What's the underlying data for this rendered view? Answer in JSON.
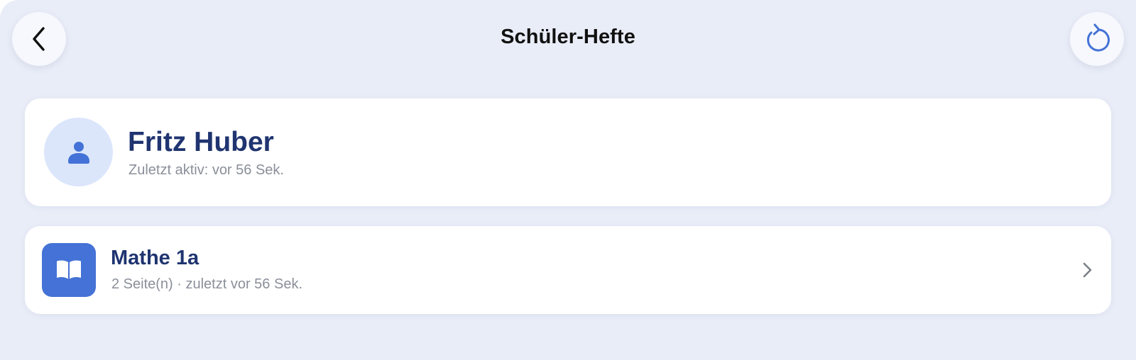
{
  "header": {
    "title": "Schüler-Hefte",
    "back_icon": "chevron-left-icon",
    "refresh_icon": "refresh-icon"
  },
  "student": {
    "name": "Fritz Huber",
    "last_active": "Zuletzt aktiv: vor 56 Sek.",
    "avatar_icon": "person-icon"
  },
  "notebooks": [
    {
      "title": "Mathe 1a",
      "meta": "2 Seite(n) · zuletzt vor 56 Sek.",
      "icon": "book-open-icon"
    }
  ],
  "colors": {
    "background": "#e9edf8",
    "accent": "#4472d6",
    "title_text": "#1f3470",
    "muted_text": "#8a8f99",
    "avatar_bg": "#dbe6fb"
  }
}
